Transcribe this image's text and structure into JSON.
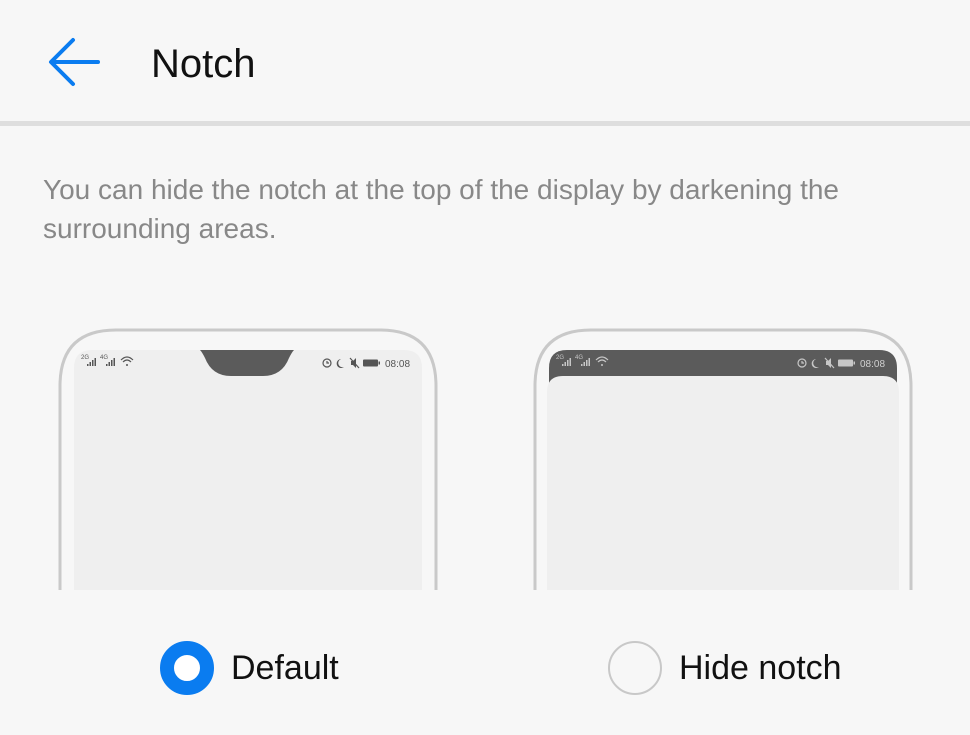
{
  "header": {
    "back_icon": "back-arrow-icon",
    "title": "Notch"
  },
  "description": "You can hide the notch at the top of the display by darkening the surrounding areas.",
  "previews": [
    {
      "id": "default",
      "status_signal_1": "2G",
      "status_signal_2": "4G",
      "time": "08:08",
      "icons": [
        "signal-icon",
        "wifi-icon",
        "alarm-icon",
        "moon-icon",
        "mute-icon",
        "battery-icon"
      ]
    },
    {
      "id": "hide-notch",
      "status_signal_1": "2G",
      "status_signal_2": "4G",
      "time": "08:08",
      "icons": [
        "signal-icon",
        "wifi-icon",
        "alarm-icon",
        "moon-icon",
        "mute-icon",
        "battery-icon"
      ]
    }
  ],
  "options": [
    {
      "label": "Default",
      "selected": true
    },
    {
      "label": "Hide notch",
      "selected": false
    }
  ],
  "colors": {
    "accent": "#0a7cf0",
    "background": "#f7f7f7",
    "notch": "#5b5b5b",
    "screen": "#efefef",
    "frame": "#c9c9c9"
  }
}
